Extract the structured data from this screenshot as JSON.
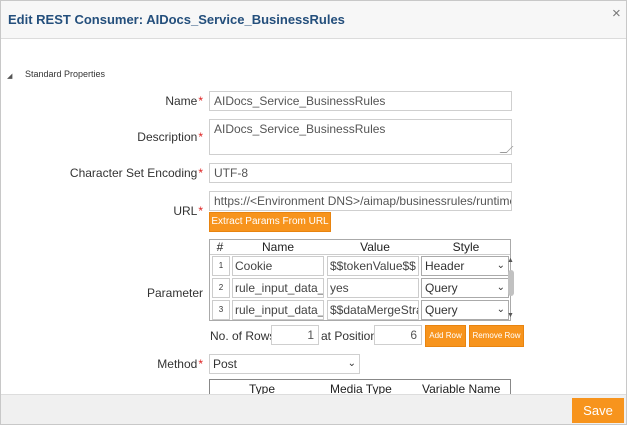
{
  "dialog": {
    "title": "Edit REST Consumer: AIDocs_Service_BusinessRules",
    "close_glyph": "×",
    "section_toggle_glyph": "◢",
    "section_label": "Standard Properties"
  },
  "form": {
    "required_mark": "*",
    "name_label": "Name",
    "name_value": "AIDocs_Service_BusinessRules",
    "description_label": "Description",
    "description_value": "AIDocs_Service_BusinessRules",
    "charset_label": "Character Set Encoding",
    "charset_value": "UTF-8",
    "url_label": "URL",
    "url_value": "https://<Environment DNS>/aimap/businessrules/runtime",
    "extract_button": "Extract Params From URL",
    "parameter_label": "Parameter",
    "method_label": "Method",
    "method_value": "Post"
  },
  "parameter_table": {
    "headers": [
      "#",
      "Name",
      "Value",
      "Style"
    ],
    "rows": [
      {
        "num": "1",
        "name": "Cookie",
        "value": "$$tokenValue$$",
        "style": "Header"
      },
      {
        "num": "2",
        "name": "rule_input_data_n",
        "value": "yes",
        "style": "Query"
      },
      {
        "num": "3",
        "name": "rule_input_data_n",
        "value": "$$dataMergeStrat",
        "style": "Query"
      }
    ],
    "caret_glyph": "⌄",
    "scroll_up_glyph": "▲",
    "scroll_down_glyph": "▼",
    "no_of_rows_label": "No. of Rows",
    "no_of_rows_value": "1",
    "at_position_label": "at Position",
    "at_position_value": "6",
    "add_row_button": "Add Row",
    "remove_row_button": "Remove Row"
  },
  "variables_table": {
    "headers": [
      "Type",
      "Media Type",
      "Variable Name"
    ]
  },
  "footer": {
    "save_button": "Save"
  },
  "colors": {
    "accent": "#f7941d",
    "title": "#244f7c",
    "required": "#d22222"
  }
}
